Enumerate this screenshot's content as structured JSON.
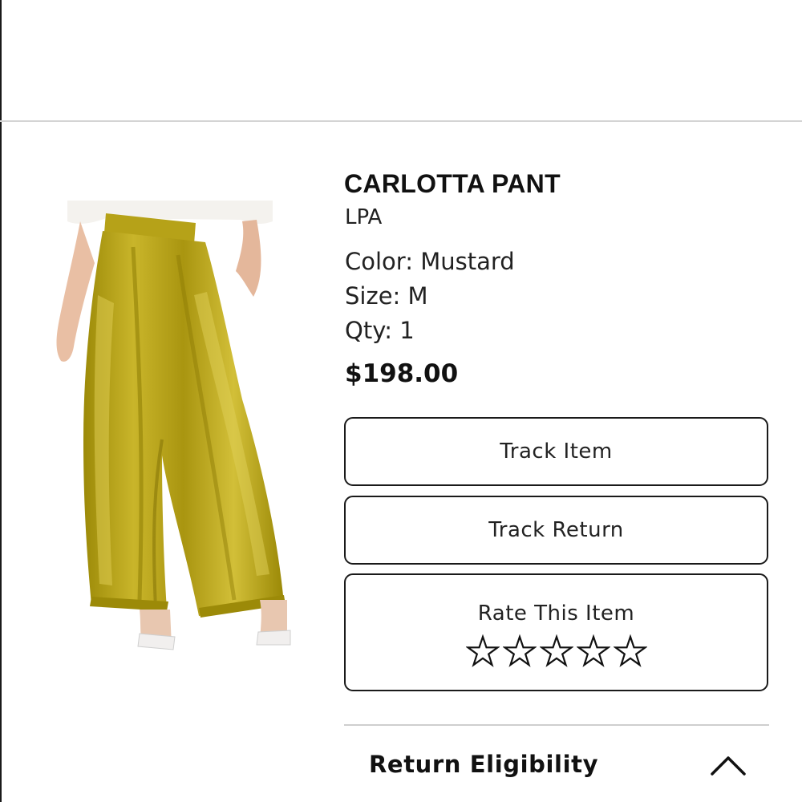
{
  "product": {
    "name": "CARLOTTA PANT",
    "brand": "LPA",
    "color_line": "Color: Mustard",
    "size_line": "Size: M",
    "qty_line": "Qty: 1",
    "price": "$198.00",
    "image_icon": "product-photo-mustard-velvet-pants"
  },
  "actions": {
    "track_item": "Track Item",
    "track_return": "Track Return"
  },
  "rating": {
    "label": "Rate This Item",
    "max_stars": 5,
    "current": 0,
    "star_icon": "star-outline-icon"
  },
  "return_section": {
    "label": "Return Eligibility",
    "chevron_icon": "chevron-up-icon"
  },
  "colors": {
    "text": "#111111",
    "border": "#1a1a1a",
    "divider": "#d4d4d4",
    "mustard": "#b9a415"
  }
}
